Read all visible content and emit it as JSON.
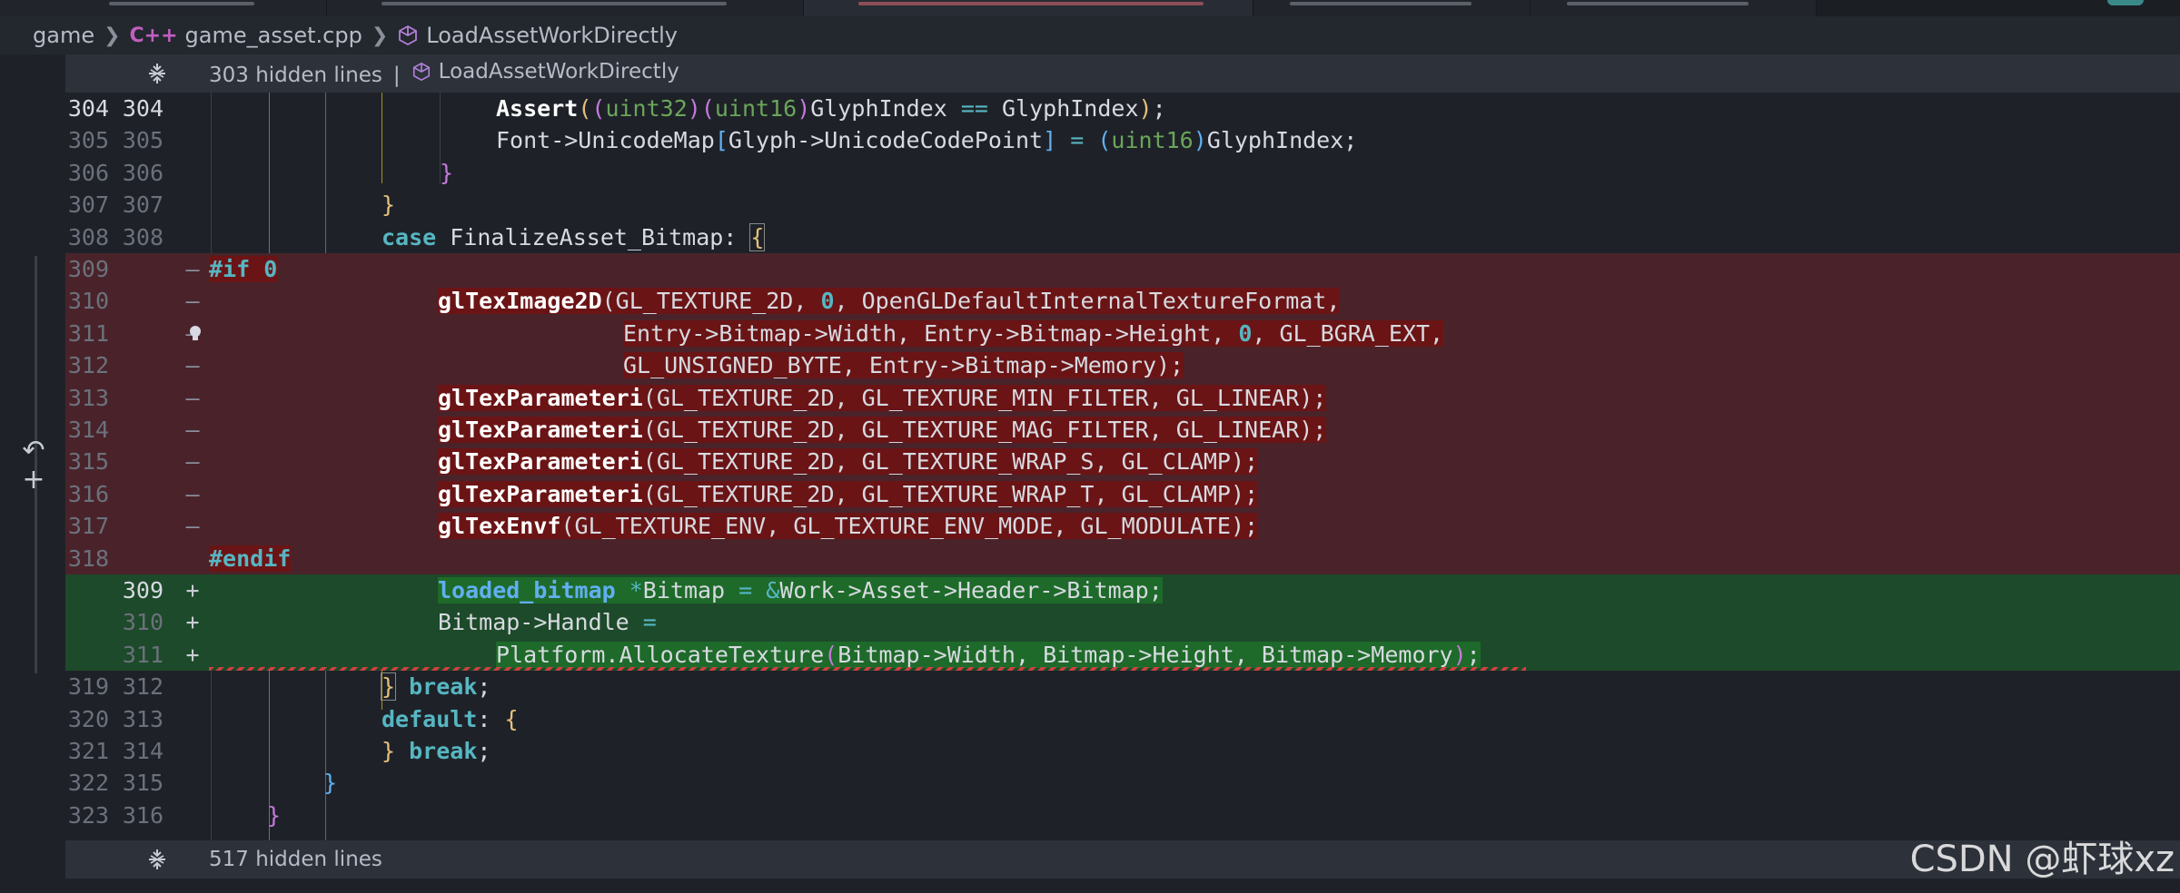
{
  "breadcrumb": {
    "root": "game",
    "file": "game_asset.cpp",
    "file_icon_text": "C++",
    "symbol": "LoadAssetWorkDirectly"
  },
  "fold_top": {
    "label": "303 hidden lines",
    "symbol": "LoadAssetWorkDirectly"
  },
  "fold_bottom": {
    "label": "517 hidden lines"
  },
  "lines": [
    {
      "old": "304",
      "new": "304",
      "mark": "",
      "state": "context",
      "cur": true
    },
    {
      "old": "305",
      "new": "305",
      "mark": "",
      "state": "context"
    },
    {
      "old": "306",
      "new": "306",
      "mark": "",
      "state": "context"
    },
    {
      "old": "307",
      "new": "307",
      "mark": "",
      "state": "context"
    },
    {
      "old": "308",
      "new": "308",
      "mark": "",
      "state": "context"
    },
    {
      "old": "309",
      "new": "",
      "mark": "—",
      "state": "removed"
    },
    {
      "old": "310",
      "new": "",
      "mark": "—",
      "state": "removed"
    },
    {
      "old": "311",
      "new": "",
      "mark": "—",
      "state": "removed"
    },
    {
      "old": "312",
      "new": "",
      "mark": "—",
      "state": "removed"
    },
    {
      "old": "313",
      "new": "",
      "mark": "—",
      "state": "removed"
    },
    {
      "old": "314",
      "new": "",
      "mark": "—",
      "state": "removed"
    },
    {
      "old": "315",
      "new": "",
      "mark": "—",
      "state": "removed"
    },
    {
      "old": "316",
      "new": "",
      "mark": "—",
      "state": "removed"
    },
    {
      "old": "317",
      "new": "",
      "mark": "—",
      "state": "removed"
    },
    {
      "old": "318",
      "new": "",
      "mark": "",
      "state": "removed"
    },
    {
      "old": "",
      "new": "309",
      "mark": "+",
      "state": "added",
      "cur": true
    },
    {
      "old": "",
      "new": "310",
      "mark": "+",
      "state": "added"
    },
    {
      "old": "",
      "new": "311",
      "mark": "+",
      "state": "added"
    },
    {
      "old": "319",
      "new": "312",
      "mark": "",
      "state": "context"
    },
    {
      "old": "320",
      "new": "313",
      "mark": "",
      "state": "context"
    },
    {
      "old": "321",
      "new": "314",
      "mark": "",
      "state": "context"
    },
    {
      "old": "322",
      "new": "315",
      "mark": "",
      "state": "context"
    },
    {
      "old": "323",
      "new": "316",
      "mark": "",
      "state": "context"
    }
  ],
  "code": {
    "l304": [
      "Assert",
      "(",
      "(",
      "uint32",
      ")",
      "(",
      "uint16",
      ")",
      "GlyphIndex ",
      "==",
      " GlyphIndex",
      ")",
      ";"
    ],
    "l305": [
      "Font->UnicodeMap",
      "[",
      "Glyph->UnicodeCodePoint",
      "]",
      " ",
      "=",
      " ",
      "(",
      "uint16",
      ")",
      "GlyphIndex;"
    ],
    "l306": [
      "}"
    ],
    "l307": [
      "}"
    ],
    "l308": [
      "case",
      " FinalizeAsset_Bitmap: ",
      "{"
    ],
    "l309": [
      "#if",
      " ",
      "0"
    ],
    "l310": [
      "glTexImage2D",
      "(GL_TEXTURE_2D, ",
      "0",
      ", OpenGLDefaultInternalTextureFormat,"
    ],
    "l311": [
      "Entry->Bitmap->Width, Entry->Bitmap->Height, ",
      "0",
      ", GL_BGRA_EXT,"
    ],
    "l312": [
      "GL_UNSIGNED_BYTE, Entry->Bitmap->Memory);"
    ],
    "l313": [
      "glTexParameteri",
      "(GL_TEXTURE_2D, GL_TEXTURE_MIN_FILTER, GL_LINEAR);"
    ],
    "l314": [
      "glTexParameteri",
      "(GL_TEXTURE_2D, GL_TEXTURE_MAG_FILTER, GL_LINEAR);"
    ],
    "l315": [
      "glTexParameteri",
      "(GL_TEXTURE_2D, GL_TEXTURE_WRAP_S, GL_CLAMP);"
    ],
    "l316": [
      "glTexParameteri",
      "(GL_TEXTURE_2D, GL_TEXTURE_WRAP_T, GL_CLAMP);"
    ],
    "l317": [
      "glTexEnvf",
      "(GL_TEXTURE_ENV, GL_TEXTURE_ENV_MODE, GL_MODULATE);"
    ],
    "l318": [
      "#endif"
    ],
    "n309": [
      "loaded_bitmap",
      " ",
      "*",
      "Bitmap ",
      "=",
      " ",
      "&",
      "Work->Asset->Header->Bitmap;"
    ],
    "n310": [
      "Bitmap->Handle ",
      "="
    ],
    "n311": [
      "Platform.AllocateTexture",
      "(",
      "Bitmap->Width, Bitmap->Height, Bitmap->Memory",
      ")",
      ";"
    ],
    "n312": [
      "}",
      " ",
      "break",
      ";"
    ],
    "n313": [
      "default",
      ": ",
      "{"
    ],
    "n314": [
      "}",
      " ",
      "break",
      ";"
    ],
    "n315": [
      "}"
    ],
    "n316": [
      "}"
    ]
  },
  "icons": {
    "file": "cpp-file-icon",
    "symbol": "method-cube-icon",
    "fold": "unfold-icon",
    "revert": "revert-arrow-icon",
    "stage": "plus-icon",
    "hint": "lightbulb-icon"
  },
  "colors": {
    "editor_bg": "#1e2228",
    "removed_bg": "#4a232a",
    "removed_highlight": "#6a1416",
    "added_bg": "#1d4a2a",
    "added_highlight": "#1e6a2a",
    "keyword": "#56b6c2",
    "type": "#6ba55a"
  },
  "watermark": "CSDN @虾球xz"
}
